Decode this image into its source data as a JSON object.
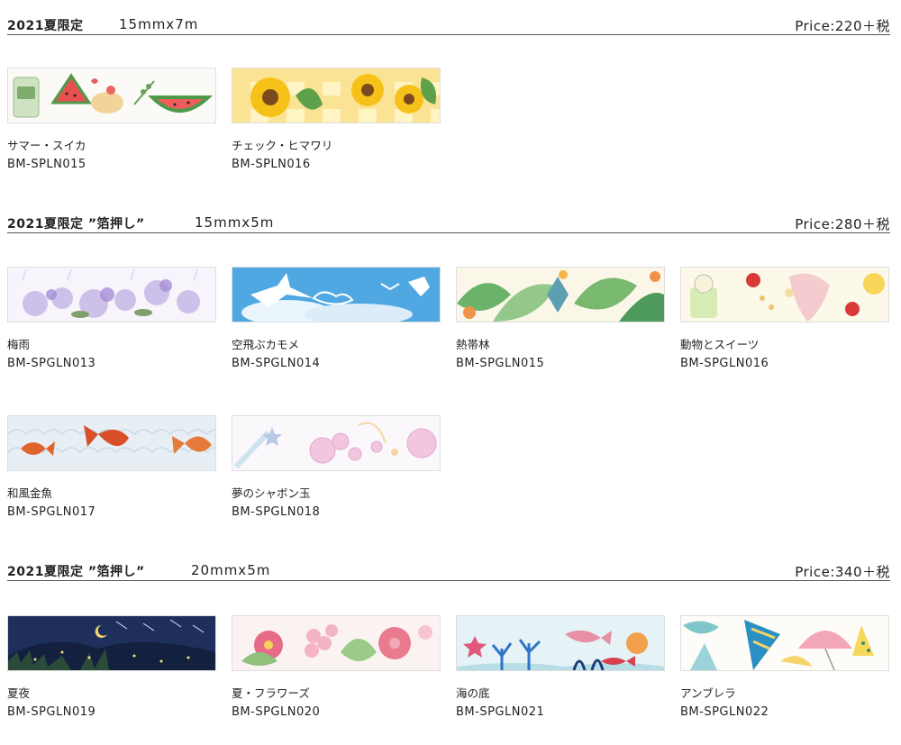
{
  "sections": [
    {
      "title": "2021夏限定",
      "size": "15mmx7m",
      "price": "Price:220＋税"
    },
    {
      "title": "2021夏限定 ”箔押し”",
      "size": "15mmx5m",
      "price": "Price:280＋税"
    },
    {
      "title": "2021夏限定 ”箔押し”",
      "size": "20mmx5m",
      "price": "Price:340＋税"
    }
  ],
  "products": [
    {
      "name": "サマー・スイカ",
      "code": "BM-SPLN015",
      "icon": "watermelon-soda-pattern-icon"
    },
    {
      "name": "チェック・ヒマワリ",
      "code": "BM-SPLN016",
      "icon": "sunflower-gingham-pattern-icon"
    },
    {
      "name": "梅雨",
      "code": "BM-SPGLN013",
      "icon": "hydrangea-rain-pattern-icon"
    },
    {
      "name": "空飛ぶカモメ",
      "code": "BM-SPGLN014",
      "icon": "seagull-sky-pattern-icon"
    },
    {
      "name": "熱帯林",
      "code": "BM-SPGLN015",
      "icon": "tropical-leaves-pattern-icon"
    },
    {
      "name": "動物とスイーツ",
      "code": "BM-SPGLN016",
      "icon": "animal-sweets-pattern-icon"
    },
    {
      "name": "和風金魚",
      "code": "BM-SPGLN017",
      "icon": "goldfish-waves-pattern-icon"
    },
    {
      "name": "夢のシャボン玉",
      "code": "BM-SPGLN018",
      "icon": "soap-bubbles-pattern-icon"
    },
    {
      "name": "夏夜",
      "code": "BM-SPGLN019",
      "icon": "summer-night-pattern-icon"
    },
    {
      "name": "夏・フラワーズ",
      "code": "BM-SPGLN020",
      "icon": "summer-flowers-pattern-icon"
    },
    {
      "name": "海の底",
      "code": "BM-SPGLN021",
      "icon": "sea-floor-pattern-icon"
    },
    {
      "name": "アンブレラ",
      "code": "BM-SPGLN022",
      "icon": "umbrellas-pattern-icon"
    }
  ]
}
